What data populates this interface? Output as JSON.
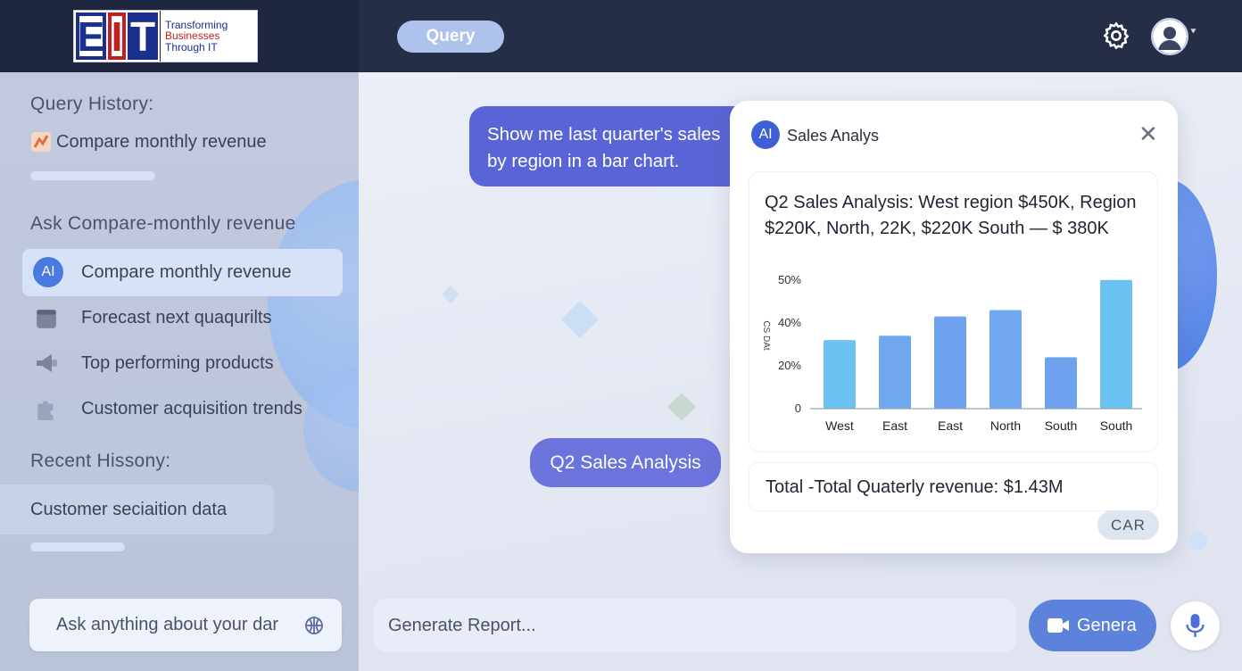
{
  "logo": {
    "letters": [
      "E",
      "I",
      "T"
    ],
    "tagline": [
      "Transforming",
      "Businesses",
      "Through IT"
    ]
  },
  "header": {
    "query_label": "Query"
  },
  "sidebar": {
    "history_title": "Query History:",
    "history_item": "Compare monthly revenue",
    "ask_title": "Ask Compare-monthly revenue",
    "items": [
      {
        "label": "Compare monthly revenue",
        "icon": "ai-badge-icon",
        "badge": "AI",
        "active": true
      },
      {
        "label": "Forecast next quaqurilts",
        "icon": "calendar-icon"
      },
      {
        "label": "Top performing products",
        "icon": "megaphone-icon"
      },
      {
        "label": "Customer acquisition trends",
        "icon": "puzzle-icon"
      }
    ],
    "recent_title": "Recent Hissony:",
    "recent_item": "Customer seciaition data",
    "ask_placeholder": "Ask anything about your dar"
  },
  "chat": {
    "user_message": "Show me last quarter's sales by region in a bar chart.",
    "ai_message": "Q2 Sales Analysis"
  },
  "panel": {
    "badge": "AI",
    "title": "Sales Analys",
    "summary": "Q2 Sales Analysis: West region $450K, Region $220K, North, 22K, $220K South — $ 380K",
    "total": "Total -Total Quaterly revenue: $1.43M",
    "car_button": "CAR"
  },
  "chart_data": {
    "type": "bar",
    "categories": [
      "West",
      "East",
      "East",
      "North",
      "South",
      "South"
    ],
    "values": [
      32,
      34,
      43,
      46,
      24,
      60
    ],
    "yticks": [
      {
        "value": 0,
        "label": "0"
      },
      {
        "value": 20,
        "label": "20%"
      },
      {
        "value": 40,
        "label": "40%"
      },
      {
        "value": 60,
        "label": "50%"
      }
    ],
    "ylabel": "CS DAt",
    "ylim": [
      0,
      62
    ],
    "colors": [
      "#6cc3f3",
      "#6fa8ef",
      "#6fa2ee",
      "#6fa8ef",
      "#6fa2ee",
      "#6cc3f3"
    ],
    "grid": false
  },
  "footer": {
    "input_placeholder": "Generate Report...",
    "generate_label": "Genera"
  },
  "colors": {
    "accent": "#5965d6",
    "header": "#262d47",
    "generate": "#5d82dc"
  }
}
